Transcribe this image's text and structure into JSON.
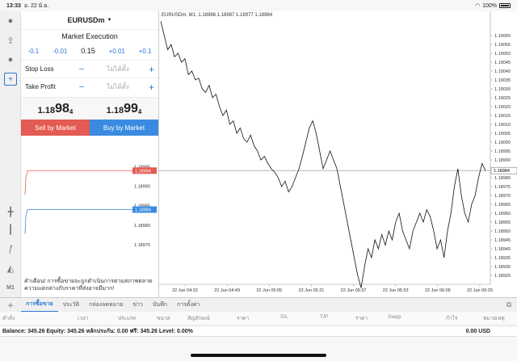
{
  "status": {
    "time": "13:33",
    "date": "อ. 22 มิ.ย.",
    "battery": "100%"
  },
  "panel": {
    "symbol": "EURUSDm",
    "execution": "Market Execution",
    "adjust": [
      "-0.1",
      "-0.01",
      "+0.01",
      "+0.1"
    ],
    "volume": "0.15",
    "stop_loss_label": "Stop Loss",
    "take_profit_label": "Take Profit",
    "placeholder": "ไม่ได้ตั้ง",
    "sell_price": {
      "prefix": "1.18",
      "big": "98",
      "sup": "4"
    },
    "buy_price": {
      "prefix": "1.18",
      "big": "99",
      "sup": "4"
    },
    "sell_label": "Sell by Market",
    "buy_label": "Buy by Market",
    "warning": "คำเตือน! การซื้อขายจะถูกดำเนินการตามสภาพตลาด ความแตกต่างกับราคาที่ส่งอาจมีมาก!"
  },
  "mini_chart": {
    "ticks": [
      "1.18995",
      "1.18990",
      "1.18985",
      "1.18980",
      "1.18975"
    ],
    "ask_label": "1.18994",
    "bid_label": "1.18984",
    "ylim": [
      1.1897,
      1.18998
    ]
  },
  "chart_data": {
    "type": "line",
    "title": "EURUSDm, M1, 1.18986 1.18987 1.18977 1.18984",
    "y_ticks": [
      "1.19060",
      "1.19055",
      "1.19050",
      "1.19045",
      "1.19040",
      "1.19035",
      "1.19030",
      "1.19025",
      "1.19020",
      "1.19015",
      "1.19010",
      "1.19005",
      "1.19000",
      "1.18995",
      "1.18990",
      "1.18985",
      "1.18980",
      "1.18975",
      "1.18970",
      "1.18965",
      "1.18960",
      "1.18955",
      "1.18950",
      "1.18945",
      "1.18940",
      "1.18935",
      "1.18930",
      "1.18925"
    ],
    "x_ticks": [
      "22 Jun 04:32",
      "22 Jun 04:49",
      "22 Jun 05:05",
      "22 Jun 05:21",
      "22 Jun 05:37",
      "22 Jun 05:53",
      "22 Jun 06:09",
      "22 Jun 06:25"
    ],
    "ylim": [
      1.1892,
      1.1907
    ],
    "current_label": "1.18984",
    "current": 1.18984,
    "values": [
      1.19068,
      1.1906,
      1.19052,
      1.19055,
      1.19048,
      1.1905,
      1.19045,
      1.19047,
      1.19038,
      1.1904,
      1.19035,
      1.19036,
      1.1903,
      1.19028,
      1.19032,
      1.19025,
      1.19027,
      1.1902,
      1.19015,
      1.19018,
      1.1901,
      1.19012,
      1.19005,
      1.19008,
      1.19002,
      1.19,
      1.19004,
      1.18998,
      1.18995,
      1.1899,
      1.18992,
      1.18988,
      1.18985,
      1.18983,
      1.1898,
      1.18975,
      1.18978,
      1.18972,
      1.18975,
      1.1898,
      1.18985,
      1.18992,
      1.19,
      1.19008,
      1.19012,
      1.19005,
      1.18995,
      1.18985,
      1.1899,
      1.18995,
      1.1899,
      1.18985,
      1.18975,
      1.18965,
      1.18955,
      1.18945,
      1.18935,
      1.18925,
      1.18918,
      1.1893,
      1.1894,
      1.18935,
      1.18945,
      1.1894,
      1.18948,
      1.18942,
      1.1895,
      1.18945,
      1.18955,
      1.1896,
      1.1895,
      1.18945,
      1.1894,
      1.1895,
      1.18955,
      1.1896,
      1.18955,
      1.18962,
      1.18958,
      1.1895,
      1.1894,
      1.18945,
      1.18935,
      1.1895,
      1.1896,
      1.18975,
      1.18985,
      1.1897,
      1.1896,
      1.18955,
      1.18965,
      1.1897,
      1.1898,
      1.18988,
      1.18984
    ]
  },
  "tabs": [
    "การซื้อขาย",
    "ประวัติ",
    "กล่องจดหมาย",
    "ข่าว",
    "บันทึก",
    "การตั้งค่า"
  ],
  "columns": [
    "คำสั่ง",
    "เวลา",
    "ประเภท",
    "ขนาด",
    "สัญลักษณ์",
    "ราคา",
    "S/L",
    "T/P",
    "ราคา",
    "Swap",
    "กำไร",
    "หมายเหตุ"
  ],
  "balance": {
    "text": "Balance: 345.26 Equity: 345.26 หลักประกัน: 0.00 ฟรี: 345.26 Level: 0.00%",
    "amount": "0.00 USD"
  },
  "colors": {
    "sell": "#e35b52",
    "buy": "#3a8be0",
    "accent": "#2a7ad6"
  }
}
